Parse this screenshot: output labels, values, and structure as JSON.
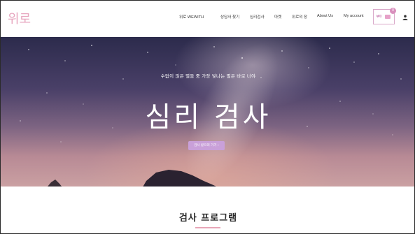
{
  "header": {
    "logo": "위로",
    "nav": [
      {
        "label": "위로 WEWITH"
      },
      {
        "label": "상담사 찾기"
      },
      {
        "label": "심리검사"
      },
      {
        "label": "마켓"
      },
      {
        "label": "위로의 장"
      },
      {
        "label": "About Us"
      },
      {
        "label": "My account"
      }
    ],
    "cart": {
      "price": "₩0",
      "count": "0",
      "icon": "cart-icon"
    },
    "user_icon": "user-icon",
    "accent_color": "#e7a6bf"
  },
  "hero": {
    "subtitle": "수없이 많은 별들 중 가장 빛나는 별은 바로 너야",
    "title": "심리 검사",
    "button_label": "검사 받으러 가기 ›",
    "button_color": "#c9a0d9"
  },
  "section": {
    "title": "검사 프로그램",
    "underline_color": "#e8a6b8"
  }
}
